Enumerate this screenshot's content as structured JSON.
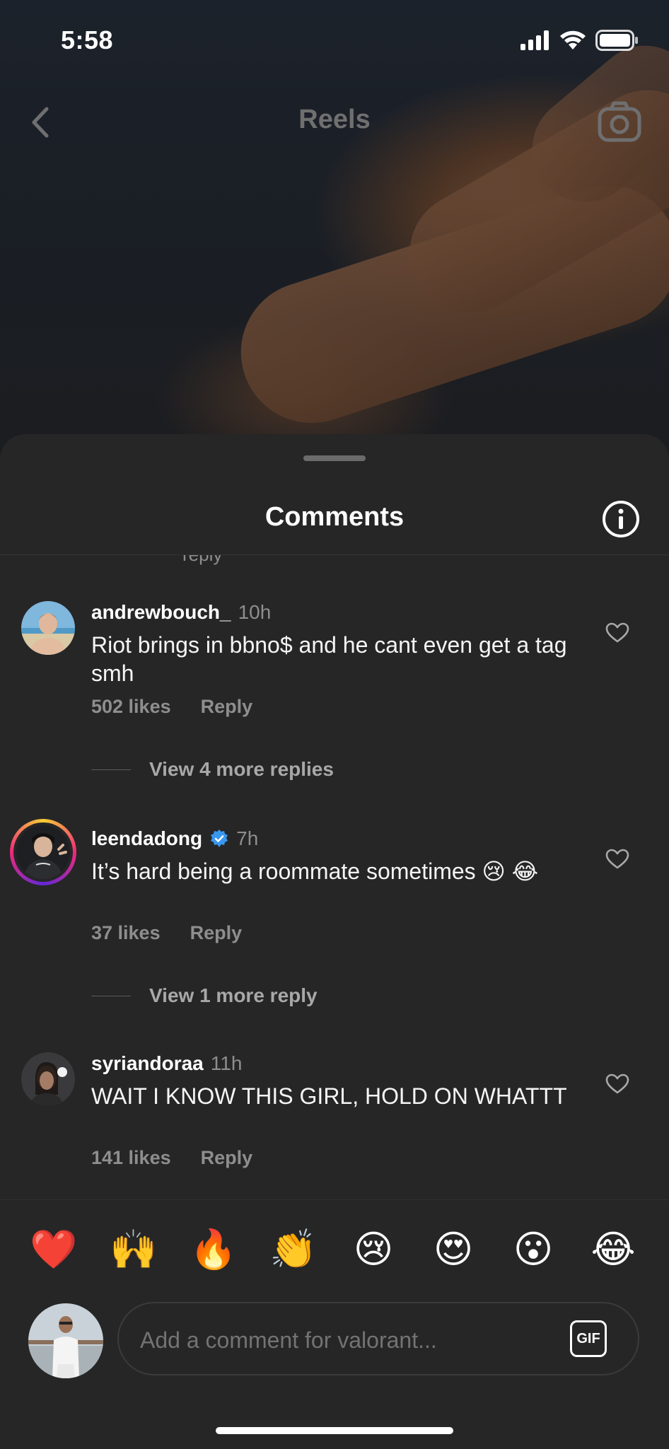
{
  "status_bar": {
    "time": "5:58"
  },
  "topbar": {
    "title": "Reels"
  },
  "sheet": {
    "title": "Comments",
    "clipped_text": "reply"
  },
  "comments": [
    {
      "username": "andrewbouch_",
      "time": "10h",
      "text": "Riot brings in bbno$ and he cant even get a tag smh",
      "likes": "502 likes",
      "reply_label": "Reply",
      "view_replies": "View 4 more replies"
    },
    {
      "username": "leendadong",
      "verified": true,
      "time": "7h",
      "text": "It’s hard being a roommate sometimes 😢 😂",
      "likes": "37 likes",
      "reply_label": "Reply",
      "view_replies": "View 1 more reply"
    },
    {
      "username": "syriandoraa",
      "time": "11h",
      "text": "WAIT I KNOW THIS GIRL, HOLD ON WHATTT",
      "likes": "141 likes",
      "reply_label": "Reply"
    }
  ],
  "emoji_bar": [
    "❤️",
    "🙌",
    "🔥",
    "👏",
    "😢",
    "😍",
    "😮",
    "😂"
  ],
  "composer": {
    "placeholder": "Add a comment for valorant...",
    "gif_label": "GIF"
  },
  "colors": {
    "sheet_bg": "#262626",
    "muted_text": "#8e8e8e",
    "verified": "#3897f0"
  }
}
